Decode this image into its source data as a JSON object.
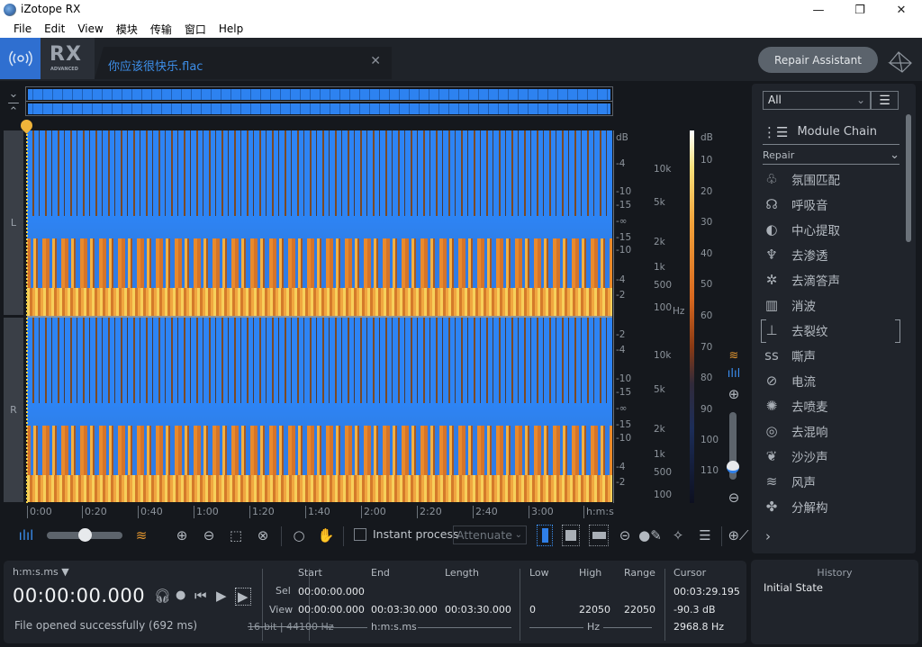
{
  "window": {
    "title": "iZotope RX",
    "minimize": "—",
    "restore": "❐",
    "close": "✕"
  },
  "menu": [
    "File",
    "Edit",
    "View",
    "模块",
    "传输",
    "窗口",
    "Help"
  ],
  "header": {
    "brand": "RX",
    "edition": "ADVANCED",
    "file_tab": "你应该很快乐.flac",
    "tab_close": "✕",
    "repair_assistant": "Repair Assistant"
  },
  "channels": [
    "L",
    "R"
  ],
  "amp_axis": {
    "unit": "dB",
    "top_ticks": [
      "-4",
      "-10",
      "-15",
      "-∞",
      "-15",
      "-10",
      "-4",
      "-2"
    ],
    "bottom_ticks": [
      "-2",
      "-4",
      "-10",
      "-15",
      "-∞",
      "-15",
      "-10",
      "-4",
      "-2"
    ]
  },
  "freq_axis": {
    "unit": "Hz",
    "ticks": [
      "10k",
      "5k",
      "2k",
      "1k",
      "500",
      "100"
    ]
  },
  "color_scale": {
    "unit": "dB",
    "ticks": [
      "10",
      "20",
      "30",
      "40",
      "50",
      "60",
      "70",
      "80",
      "90",
      "100",
      "110"
    ]
  },
  "timeline": {
    "ticks": [
      "0:00",
      "0:20",
      "0:40",
      "1:00",
      "1:20",
      "1:40",
      "2:00",
      "2:20",
      "2:40",
      "3:00"
    ],
    "unit": "h:m:s"
  },
  "toolbar": {
    "instant_process_label": "Instant process",
    "instant_process_checked": false,
    "mode_select": "Attenuate",
    "waveform_spectrogram_blend": 0.5
  },
  "vertical_zoom_level": 0.1,
  "module_panel": {
    "filter": "All",
    "module_chain": "Module Chain",
    "category": "Repair",
    "modules": [
      {
        "icon": "ambience-match-icon",
        "glyph": "♧",
        "label": "氛围匹配"
      },
      {
        "icon": "breath-icon",
        "glyph": "☊",
        "label": "呼吸音"
      },
      {
        "icon": "center-extract-icon",
        "glyph": "◐",
        "label": "中心提取"
      },
      {
        "icon": "de-bleed-icon",
        "glyph": "♆",
        "label": "去渗透"
      },
      {
        "icon": "de-click-icon",
        "glyph": "✲",
        "label": "去滴答声"
      },
      {
        "icon": "de-clip-icon",
        "glyph": "▥",
        "label": "消波"
      },
      {
        "icon": "de-crackle-icon",
        "glyph": "⊥",
        "label": "去裂纹"
      },
      {
        "icon": "de-ess-icon",
        "glyph": "ss",
        "label": "嘶声"
      },
      {
        "icon": "de-hum-icon",
        "glyph": "⊘",
        "label": "电流"
      },
      {
        "icon": "de-plosive-icon",
        "glyph": "✺",
        "label": "去喷麦"
      },
      {
        "icon": "de-reverb-icon",
        "glyph": "◎",
        "label": "去混响"
      },
      {
        "icon": "de-rustle-icon",
        "glyph": "❦",
        "label": "沙沙声"
      },
      {
        "icon": "de-wind-icon",
        "glyph": "≋",
        "label": "风声"
      },
      {
        "icon": "deconstruct-icon",
        "glyph": "✤",
        "label": "分解构"
      }
    ],
    "more": "›"
  },
  "info": {
    "time_format": "h:m:s.ms ▼",
    "current_time": "00:00:00.000",
    "status": "File opened successfully (692 ms)",
    "format": "16-bit | 44100 Hz",
    "headers": {
      "start": "Start",
      "end": "End",
      "length": "Length",
      "low": "Low",
      "high": "High",
      "range": "Range",
      "cursor": "Cursor"
    },
    "sel_label": "Sel",
    "view_label": "View",
    "sel": {
      "start": "00:00:00.000"
    },
    "view": {
      "start": "00:00:00.000",
      "end": "00:03:30.000",
      "length": "00:03:30.000",
      "low": "0",
      "high": "22050",
      "range": "22050"
    },
    "time_unit": "h:m:s.ms",
    "freq_unit": "Hz",
    "cursor": {
      "time": "00:03:29.195",
      "level": "-90.3 dB",
      "freq": "2968.8 Hz"
    }
  },
  "history": {
    "title": "History",
    "items": [
      "Initial State"
    ]
  }
}
